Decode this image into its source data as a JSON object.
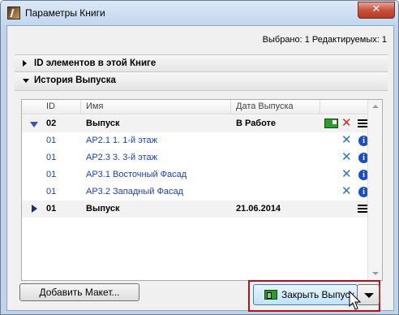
{
  "window": {
    "title": "Параметры Книги",
    "close_glyph": "✕"
  },
  "status": {
    "selected_text": "Выбрано: 1 Редактируемых: 1"
  },
  "sections": [
    {
      "label": "ID элементов в этой Книге",
      "state": "collapsed"
    },
    {
      "label": "История Выпуска",
      "state": "expanded"
    }
  ],
  "table": {
    "columns": {
      "id": "ID",
      "name": "Имя",
      "date": "Дата Выпуска"
    },
    "rows": [
      {
        "type": "issue",
        "id": "02",
        "name": "Выпуск",
        "date": "В Работе",
        "icons": [
          "layout-green-icon",
          "delete-red-x-icon",
          "list-icon"
        ],
        "expanded": true
      },
      {
        "type": "layout",
        "id": "01",
        "name": "АР2.1 1. 1-й этаж",
        "icons": [
          "remove-blue-x-icon",
          "info-icon"
        ]
      },
      {
        "type": "layout",
        "id": "01",
        "name": "АР2.3 3. 3-й этаж",
        "icons": [
          "remove-blue-x-icon",
          "info-icon"
        ]
      },
      {
        "type": "layout",
        "id": "01",
        "name": "АР3.1 Восточный Фасад",
        "icons": [
          "remove-blue-x-icon",
          "info-icon"
        ]
      },
      {
        "type": "layout",
        "id": "01",
        "name": "АР3.2 Западный Фасад",
        "icons": [
          "remove-blue-x-icon",
          "info-icon"
        ]
      },
      {
        "type": "issue",
        "id": "01",
        "name": "Выпуск",
        "date": "21.06.2014",
        "icons": [
          "list-icon"
        ],
        "expanded": false
      }
    ]
  },
  "buttons": {
    "add_layout": "Добавить Макет...",
    "close_issue": "Закрыть Выпуск"
  },
  "colors": {
    "highlight": "#b3111f",
    "child_text": "#1c3fbf",
    "accent_green": "#2f9a2f"
  }
}
